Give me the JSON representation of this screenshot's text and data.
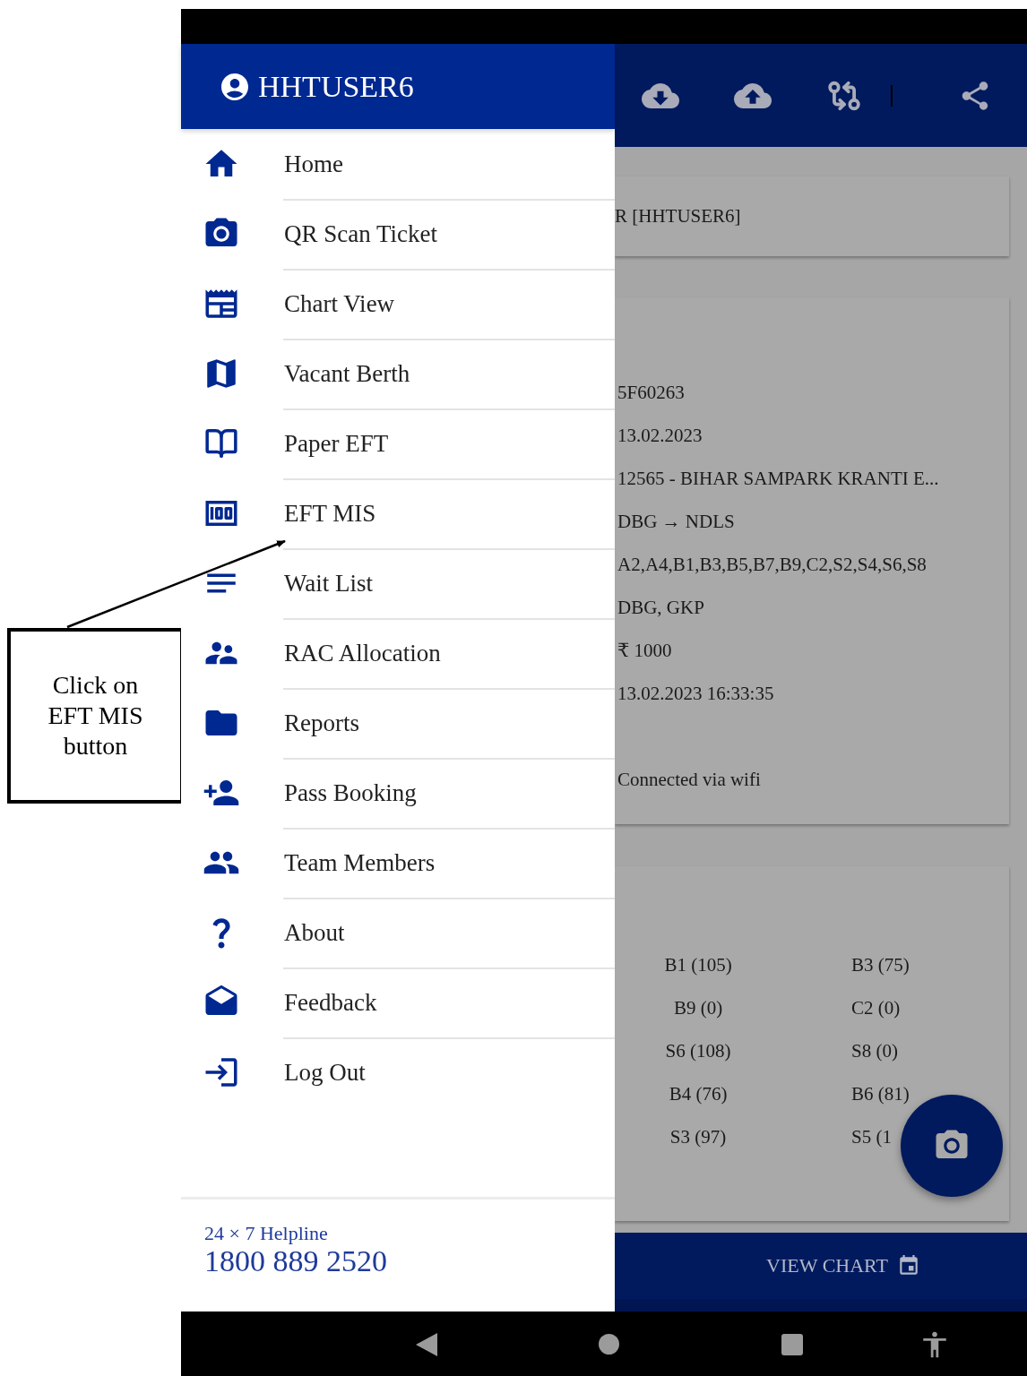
{
  "annotation": {
    "lines": [
      "Click on",
      "EFT MIS",
      "button"
    ]
  },
  "drawer": {
    "user": "HHTUSER6",
    "items": [
      {
        "label": "Home"
      },
      {
        "label": "QR Scan Ticket"
      },
      {
        "label": "Chart View"
      },
      {
        "label": "Vacant Berth"
      },
      {
        "label": "Paper EFT"
      },
      {
        "label": "EFT MIS"
      },
      {
        "label": "Wait List"
      },
      {
        "label": "RAC Allocation"
      },
      {
        "label": "Reports"
      },
      {
        "label": "Pass Booking"
      },
      {
        "label": "Team Members"
      },
      {
        "label": "About"
      },
      {
        "label": "Feedback"
      },
      {
        "label": "Log Out"
      }
    ],
    "helpline": {
      "label": "24 × 7 Helpline",
      "number": "1800 889 2520"
    }
  },
  "background": {
    "user_text": "R [HHTUSER6]",
    "details": [
      "5F60263",
      "13.02.2023",
      "12565 - BIHAR SAMPARK KRANTI E...",
      "DBG → NDLS",
      "A2,A4,B1,B3,B5,B7,B9,C2,S2,S4,S6,S8",
      "DBG, GKP",
      "₹ 1000",
      "13.02.2023 16:33:35"
    ],
    "status": "Connected via wifi",
    "coaches": [
      "B1 (105)",
      "B3 (75)",
      "B9 (0)",
      "C2 (0)",
      "S6 (108)",
      "S8 (0)",
      "B4 (76)",
      "B6 (81)",
      "S3 (97)",
      "S5 (1"
    ],
    "button": "VIEW CHART"
  }
}
